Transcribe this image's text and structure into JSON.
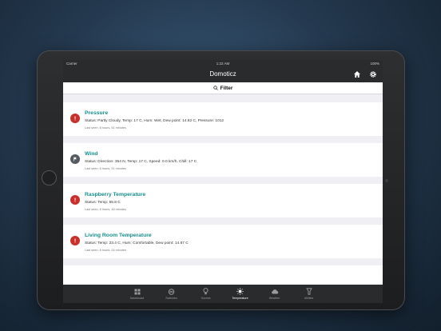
{
  "statusbar": {
    "carrier": "Carrier",
    "time": "1:22 AM",
    "battery": "100%"
  },
  "navbar": {
    "title": "Domoticz",
    "home_icon": "home-icon",
    "settings_icon": "gear-icon"
  },
  "filter": {
    "label": "Filter",
    "icon": "search-icon"
  },
  "devices": [
    {
      "name": "Pressure",
      "status": "Status: Partly Cloudy, Temp: 17 C, Hum: Wet, Dew point: 14.82 C, Pressure: 1012",
      "last_seen": "Last seen: 8 hours, 51 minutes",
      "icon": "alert-icon",
      "color": "#c9302c"
    },
    {
      "name": "Wind",
      "status": "Status: Direction: 354 N, Temp: 17 C, Speed: 0.0 km/h, Chill: 17 C",
      "last_seen": "Last seen: 8 hours, 51 minutes",
      "icon": "flag-icon",
      "color": "#555a60"
    },
    {
      "name": "Raspberry Temperature",
      "status": "Status: Temp: 55.8 C",
      "last_seen": "Last seen: 8 hours, 48 minutes",
      "icon": "alert-icon",
      "color": "#c9302c"
    },
    {
      "name": "Living Room Temperature",
      "status": "Status: Temp: 23.4 C, Hum: Comfortable, Dew point: 14.67 C",
      "last_seen": "Last seen: 8 hours, 24 minutes",
      "icon": "alert-icon",
      "color": "#c9302c"
    }
  ],
  "tabs": [
    {
      "label": "Dashboard",
      "icon": "dashboard-icon",
      "active": false
    },
    {
      "label": "Switches",
      "icon": "switches-icon",
      "active": false
    },
    {
      "label": "Scenes",
      "icon": "lightbulb-icon",
      "active": false
    },
    {
      "label": "Temperature",
      "icon": "sun-icon",
      "active": true
    },
    {
      "label": "Weather",
      "icon": "cloud-icon",
      "active": false
    },
    {
      "label": "Utilities",
      "icon": "utilities-icon",
      "active": false
    }
  ],
  "colors": {
    "accent": "#14908a",
    "alert": "#c9302c",
    "bar": "#2a2b2d"
  }
}
